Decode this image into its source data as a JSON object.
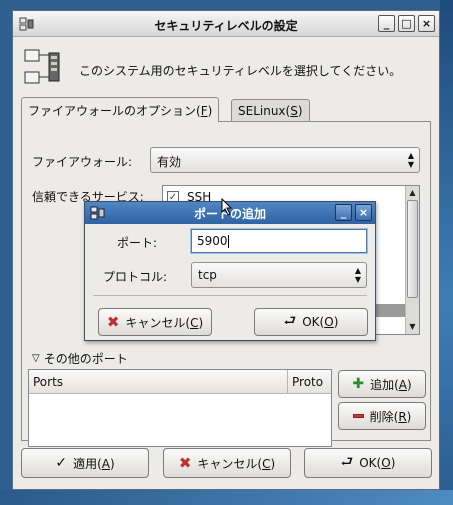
{
  "window": {
    "title": "セキュリティレベルの設定",
    "header_text": "このシステム用のセキュリティレベルを選択してください。"
  },
  "tabs": [
    {
      "label": "ファイアウォールのオプション(",
      "mnemonic": "F",
      "suffix": ")"
    },
    {
      "label": "SELinux(",
      "mnemonic": "S",
      "suffix": ")"
    }
  ],
  "firewall": {
    "label": "ファイアウォール:",
    "value": "有効"
  },
  "services": {
    "label": "信頼できるサービス:",
    "items": [
      {
        "label": "SSH",
        "checked": true
      }
    ]
  },
  "other_ports": {
    "expander_label": "その他のポート",
    "columns": [
      "Ports",
      "Proto"
    ],
    "add_button": {
      "label": "追加(",
      "mnemonic": "A",
      "suffix": ")"
    },
    "delete_button": {
      "label": "削除(",
      "mnemonic": "R",
      "suffix": ")"
    }
  },
  "bottom_buttons": {
    "apply": {
      "label": "適用(",
      "mnemonic": "A",
      "suffix": ")"
    },
    "cancel": {
      "label": "キャンセル(",
      "mnemonic": "C",
      "suffix": ")"
    },
    "ok": {
      "label": "OK(",
      "mnemonic": "O",
      "suffix": ")"
    }
  },
  "dialog": {
    "title": "ポートの追加",
    "port_label": "ポート:",
    "port_value": "5900",
    "protocol_label": "プロトコル:",
    "protocol_value": "tcp",
    "cancel": {
      "label": "キャンセル(",
      "mnemonic": "C",
      "suffix": ")"
    },
    "ok": {
      "label": "OK(",
      "mnemonic": "O",
      "suffix": ")"
    }
  },
  "colors": {
    "window_bg": "#ecebe7",
    "dialog_titlebar": "#2f63a4",
    "desktop": "#2e5f8f"
  }
}
